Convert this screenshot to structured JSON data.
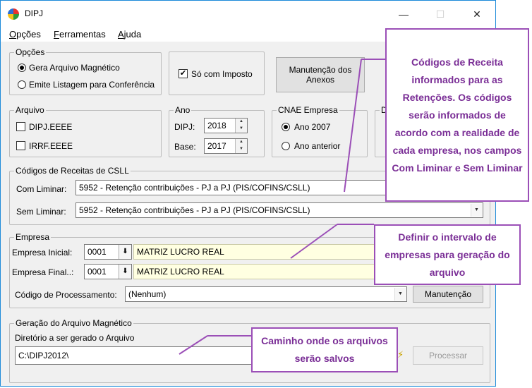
{
  "window": {
    "title": "DIPJ",
    "controls": {
      "minimize": "—",
      "maximize": "☐",
      "close": "✕"
    }
  },
  "menu": [
    {
      "label": "Opções",
      "hot": "O",
      "rest": "pções"
    },
    {
      "label": "Ferramentas",
      "hot": "F",
      "rest": "erramentas"
    },
    {
      "label": "Ajuda",
      "hot": "A",
      "rest": "juda"
    }
  ],
  "opcoes": {
    "legend": "Opções",
    "radio1": "Gera Arquivo Magnético",
    "radio2": "Emite Listagem para Conferência",
    "selected": "Gera Arquivo Magnético"
  },
  "so_com_imposto": {
    "label": "Só com Imposto",
    "checked": true
  },
  "manutencao_anexos": {
    "label_line1": "Manutenção dos",
    "label_line2": "Anexos"
  },
  "arquivo": {
    "legend": "Arquivo",
    "opt1": "DIPJ.EEEE",
    "opt2": "IRRF.EEEE"
  },
  "ano": {
    "legend": "Ano",
    "dipj_label": "DIPJ:",
    "dipj_value": "2018",
    "base_label": "Base:",
    "base_value": "2017"
  },
  "cnae": {
    "legend": "CNAE Empresa",
    "opt1": "Ano 2007",
    "opt2": "Ano anterior",
    "selected": "Ano 2007"
  },
  "partial_group_legend": "D",
  "csll": {
    "legend": "Códigos de Receitas de CSLL",
    "com_liminar_label": "Com Liminar:",
    "com_liminar_value": "5952 - Retenção contribuições - PJ a PJ (PIS/COFINS/CSLL)",
    "sem_liminar_label": "Sem Liminar:",
    "sem_liminar_value": "5952 - Retenção contribuições - PJ a PJ (PIS/COFINS/CSLL)"
  },
  "empresa": {
    "legend": "Empresa",
    "inicial_label": "Empresa Inicial:",
    "inicial_code": "0001",
    "inicial_name": "MATRIZ LUCRO REAL",
    "final_label": "Empresa Final..:",
    "final_code": "0001",
    "final_name": "MATRIZ LUCRO REAL",
    "codproc_label": "Código de Processamento:",
    "codproc_value": "(Nenhum)",
    "manutencao": "Manutenção"
  },
  "geracao": {
    "legend": "Geração do Arquivo Magnético",
    "dir_label": "Diretório a ser gerado o Arquivo",
    "dir_value": "C:\\DIPJ2012\\",
    "processar": "Processar"
  },
  "callouts": {
    "receita": "Códigos de Receita informados para as Retenções. Os códigos serão informados de acordo com a realidade de cada empresa, nos campos Com Liminar e Sem Liminar",
    "intervalo": "Definir o intervalo de empresas para geração do arquivo",
    "caminho": "Caminho onde os arquivos serão salvos"
  },
  "colors": {
    "callout_border": "#9b4fb7",
    "callout_text": "#7a2e96",
    "field_highlight": "#ffffe1",
    "window_border": "#1c8ad9"
  },
  "icons": [
    "app-icon",
    "radio-icon",
    "checkbox-icon",
    "spin-icon",
    "dropdown-icon",
    "folder-icon"
  ]
}
